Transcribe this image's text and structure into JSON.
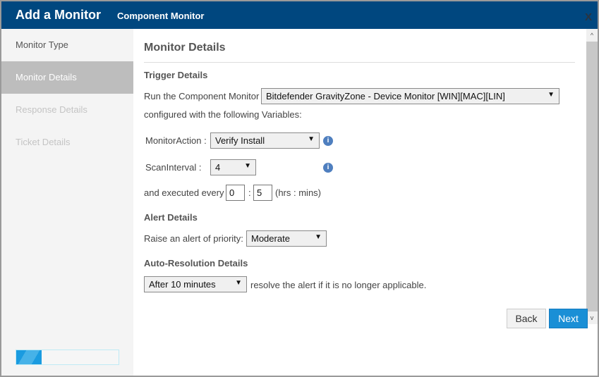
{
  "header": {
    "title": "Add a Monitor",
    "subtitle": "Component Monitor",
    "close": "X"
  },
  "sidebar": {
    "items": [
      {
        "label": "Monitor Type",
        "state": "completed"
      },
      {
        "label": "Monitor Details",
        "state": "active"
      },
      {
        "label": "Response Details",
        "state": "disabled"
      },
      {
        "label": "Ticket Details",
        "state": "disabled"
      }
    ],
    "progress_percent": 25
  },
  "main": {
    "title": "Monitor Details",
    "trigger": {
      "heading": "Trigger Details",
      "run_label": "Run the Component Monitor",
      "component": "Bitdefender GravityZone - Device Monitor [WIN][MAC][LIN]",
      "configured_label": "configured with the following Variables:",
      "variables": [
        {
          "label": "MonitorAction :",
          "value": "Verify Install"
        },
        {
          "label": "ScanInterval :",
          "value": "4"
        }
      ],
      "executed_label": "and executed every",
      "hours": "0",
      "sep": ":",
      "minutes": "5",
      "units": "(hrs : mins)"
    },
    "alert": {
      "heading": "Alert Details",
      "label": "Raise an alert of priority:",
      "priority": "Moderate"
    },
    "autores": {
      "heading": "Auto-Resolution Details",
      "value": "After 10 minutes",
      "label": "resolve the alert if it is no longer applicable."
    }
  },
  "footer": {
    "back": "Back",
    "next": "Next"
  },
  "colors": {
    "header": "#00477f",
    "accent": "#1a8fd6"
  }
}
